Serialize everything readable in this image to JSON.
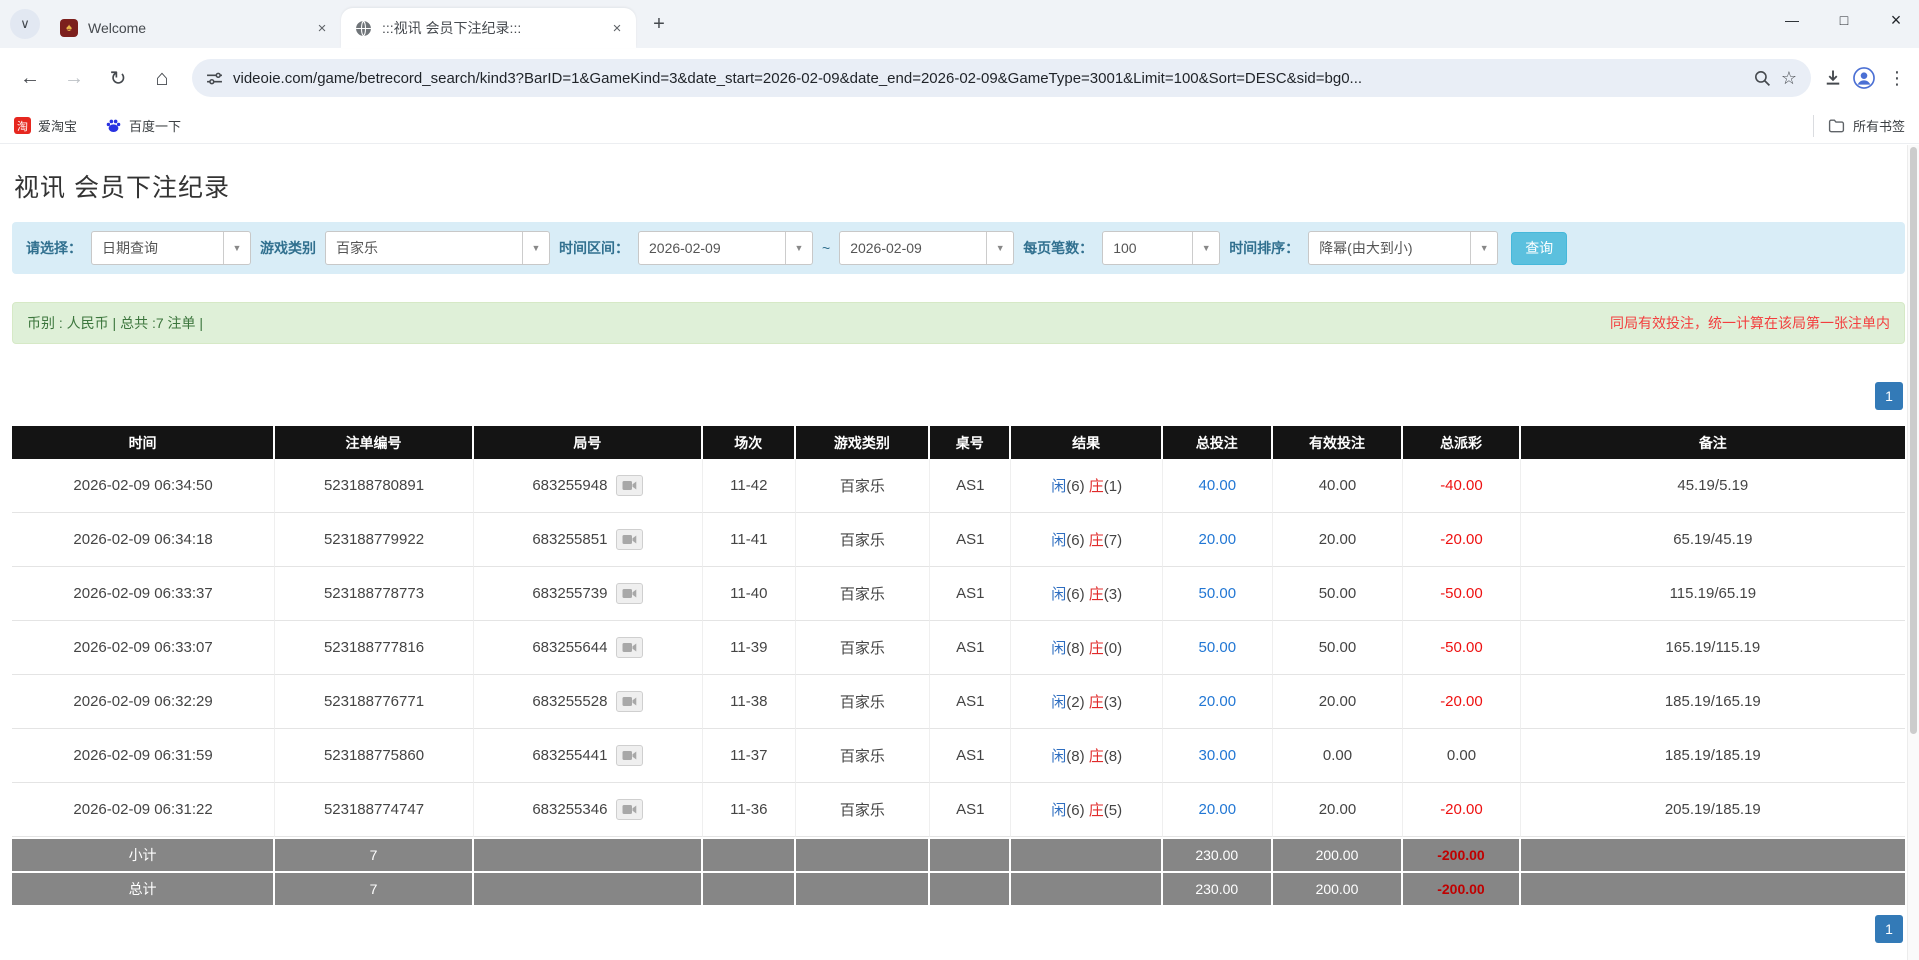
{
  "icons": {
    "chevron_down": "∨",
    "back": "←",
    "forward": "→",
    "reload": "↻",
    "home": "⌂",
    "minimize": "—",
    "maximize": "□",
    "close": "×",
    "tab_close": "×",
    "new_tab": "+",
    "select_arrow": "▼",
    "menu": "⋮",
    "star": "☆",
    "taobao_glyph": "淘"
  },
  "browser": {
    "tabs": [
      {
        "title": "Welcome",
        "active": false
      },
      {
        "title": ":::视讯 会员下注纪录:::",
        "active": true
      }
    ],
    "url": "videoie.com/game/betrecord_search/kind3?BarID=1&GameKind=3&date_start=2026-02-09&date_end=2026-02-09&GameType=3001&Limit=100&Sort=DESC&sid=bg0...",
    "bookmarks": [
      {
        "label": "爱淘宝"
      },
      {
        "label": "百度一下"
      }
    ],
    "all_bookmarks_label": "所有书签"
  },
  "page": {
    "title": "视讯 会员下注纪录",
    "filters": {
      "select_label": "请选择：",
      "select_value": "日期查询",
      "game_kind_label": "游戏类别",
      "game_kind_value": "百家乐",
      "date_range_label": "时间区间：",
      "date_start": "2026-02-09",
      "range_separator": "~",
      "date_end": "2026-02-09",
      "per_page_label": "每页笔数：",
      "per_page_value": "100",
      "sort_label": "时间排序：",
      "sort_value": "降幂(由大到小)",
      "search_button": "查询"
    },
    "summary": {
      "left": "币别 : 人民币 | 总共 :7 注单 |",
      "right": "同局有效投注，统一计算在该局第一张注单内"
    },
    "pagination": {
      "page": "1"
    },
    "table": {
      "headers": [
        "时间",
        "注单编号",
        "局号",
        "场次",
        "游戏类别",
        "桌号",
        "结果",
        "总投注",
        "有效投注",
        "总派彩",
        "备注"
      ],
      "rows": [
        {
          "time": "2026-02-09 06:34:50",
          "bet_id": "523188780891",
          "round": "683255948",
          "session": "11-42",
          "game": "百家乐",
          "table_no": "AS1",
          "player": "闲",
          "player_n": "(6)",
          "banker": "庄",
          "banker_n": "(1)",
          "total_bet": "40.00",
          "valid_bet": "40.00",
          "payout": "-40.00",
          "remark": "45.19/5.19"
        },
        {
          "time": "2026-02-09 06:34:18",
          "bet_id": "523188779922",
          "round": "683255851",
          "session": "11-41",
          "game": "百家乐",
          "table_no": "AS1",
          "player": "闲",
          "player_n": "(6)",
          "banker": "庄",
          "banker_n": "(7)",
          "total_bet": "20.00",
          "valid_bet": "20.00",
          "payout": "-20.00",
          "remark": "65.19/45.19"
        },
        {
          "time": "2026-02-09 06:33:37",
          "bet_id": "523188778773",
          "round": "683255739",
          "session": "11-40",
          "game": "百家乐",
          "table_no": "AS1",
          "player": "闲",
          "player_n": "(6)",
          "banker": "庄",
          "banker_n": "(3)",
          "total_bet": "50.00",
          "valid_bet": "50.00",
          "payout": "-50.00",
          "remark": "115.19/65.19"
        },
        {
          "time": "2026-02-09 06:33:07",
          "bet_id": "523188777816",
          "round": "683255644",
          "session": "11-39",
          "game": "百家乐",
          "table_no": "AS1",
          "player": "闲",
          "player_n": "(8)",
          "banker": "庄",
          "banker_n": "(0)",
          "total_bet": "50.00",
          "valid_bet": "50.00",
          "payout": "-50.00",
          "remark": "165.19/115.19"
        },
        {
          "time": "2026-02-09 06:32:29",
          "bet_id": "523188776771",
          "round": "683255528",
          "session": "11-38",
          "game": "百家乐",
          "table_no": "AS1",
          "player": "闲",
          "player_n": "(2)",
          "banker": "庄",
          "banker_n": "(3)",
          "total_bet": "20.00",
          "valid_bet": "20.00",
          "payout": "-20.00",
          "remark": "185.19/165.19"
        },
        {
          "time": "2026-02-09 06:31:59",
          "bet_id": "523188775860",
          "round": "683255441",
          "session": "11-37",
          "game": "百家乐",
          "table_no": "AS1",
          "player": "闲",
          "player_n": "(8)",
          "banker": "庄",
          "banker_n": "(8)",
          "total_bet": "30.00",
          "valid_bet": "0.00",
          "payout": "0.00",
          "remark": "185.19/185.19"
        },
        {
          "time": "2026-02-09 06:31:22",
          "bet_id": "523188774747",
          "round": "683255346",
          "session": "11-36",
          "game": "百家乐",
          "table_no": "AS1",
          "player": "闲",
          "player_n": "(6)",
          "banker": "庄",
          "banker_n": "(5)",
          "total_bet": "20.00",
          "valid_bet": "20.00",
          "payout": "-20.00",
          "remark": "205.19/185.19"
        }
      ],
      "subtotal": {
        "label": "小计",
        "count": "7",
        "total_bet": "230.00",
        "valid_bet": "200.00",
        "payout": "-200.00"
      },
      "total": {
        "label": "总计",
        "count": "7",
        "total_bet": "230.00",
        "valid_bet": "200.00",
        "payout": "-200.00"
      }
    }
  }
}
